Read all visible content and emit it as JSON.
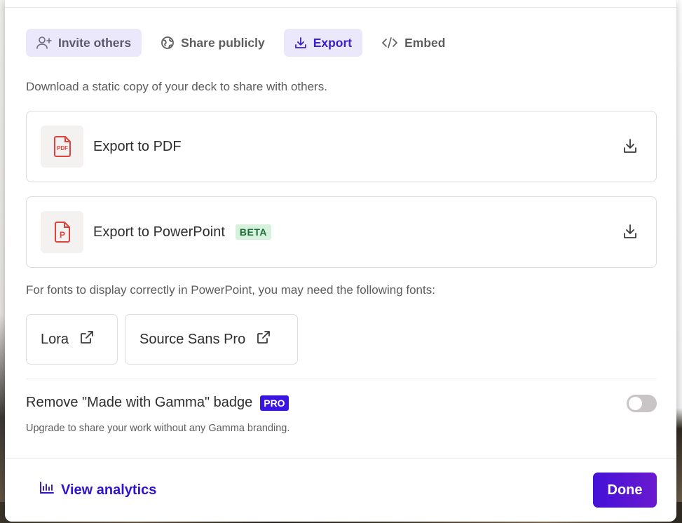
{
  "tabs": [
    {
      "label": "Invite others",
      "icon": "user-plus-icon"
    },
    {
      "label": "Share publicly",
      "icon": "globe-icon"
    },
    {
      "label": "Export",
      "icon": "download-icon",
      "active": true
    },
    {
      "label": "Embed",
      "icon": "code-icon"
    }
  ],
  "export": {
    "description": "Download a static copy of your deck to share with others.",
    "pdf": {
      "label": "Export to PDF",
      "icon": "pdf-file-icon",
      "icon_text": "PDF"
    },
    "pptx": {
      "label": "Export to PowerPoint",
      "badge": "BETA",
      "icon": "powerpoint-file-icon",
      "icon_text": "P"
    }
  },
  "fonts": {
    "note": "For fonts to display correctly in PowerPoint, you may need the following fonts:",
    "items": [
      {
        "label": "Lora",
        "icon": "external-link-icon"
      },
      {
        "label": "Source Sans Pro",
        "icon": "external-link-icon"
      }
    ]
  },
  "branding": {
    "label": "Remove \"Made with Gamma\" badge",
    "badge": "PRO",
    "toggle_on": false,
    "note": "Upgrade to share your work without any Gamma branding."
  },
  "footer": {
    "analytics_label": "View analytics",
    "done_label": "Done"
  },
  "colors": {
    "accent": "#3a14e0",
    "tab_bg": "#ebe8fc",
    "pdf_red": "#e0413a",
    "beta_bg": "#d6f2dc"
  }
}
